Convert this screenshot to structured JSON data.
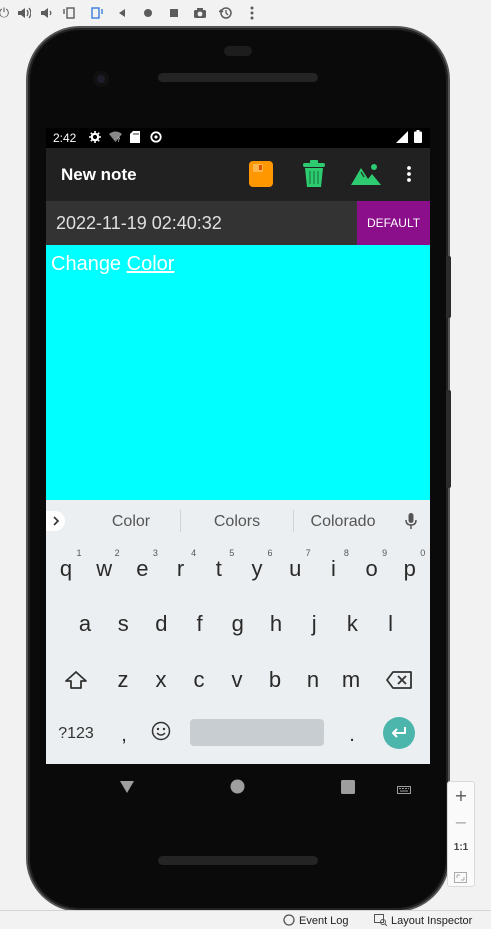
{
  "status": {
    "time": "2:42"
  },
  "appbar": {
    "title": "New note"
  },
  "note": {
    "date": "2022-11-19 02:40:32",
    "color_button": "DEFAULT",
    "text_plain": "Change ",
    "text_underlined": "Color",
    "background": "#00ffff"
  },
  "keyboard": {
    "suggestions": [
      "Color",
      "Colors",
      "Colorado"
    ],
    "row1": [
      "q",
      "w",
      "e",
      "r",
      "t",
      "y",
      "u",
      "i",
      "o",
      "p"
    ],
    "row1_hints": [
      "1",
      "2",
      "3",
      "4",
      "5",
      "6",
      "7",
      "8",
      "9",
      "0"
    ],
    "row2": [
      "a",
      "s",
      "d",
      "f",
      "g",
      "h",
      "j",
      "k",
      "l"
    ],
    "row3": [
      "z",
      "x",
      "c",
      "v",
      "b",
      "n",
      "m"
    ],
    "symbols_key": "?123",
    "comma": ",",
    "period": "."
  },
  "emulator": {
    "zoom_ratio": "1:1"
  },
  "ide": {
    "event_log": "Event Log",
    "layout_inspector": "Layout Inspector"
  },
  "colors": {
    "accent_purple": "#8b0e8b",
    "note_cyan": "#00ffff",
    "appbar": "#212121",
    "enter_key": "#4db6ac"
  }
}
